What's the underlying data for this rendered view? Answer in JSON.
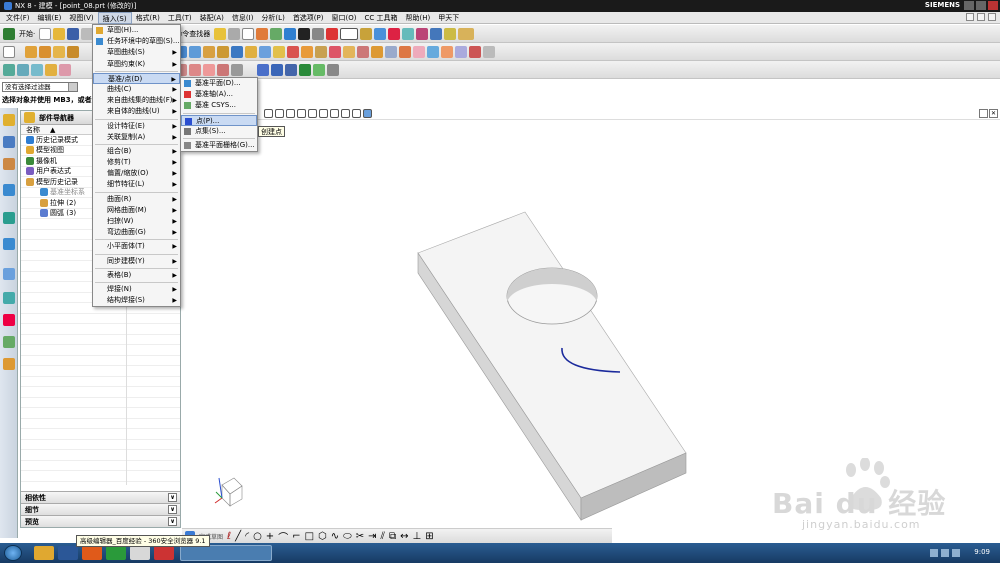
{
  "window": {
    "title": "NX 8 - 建模 - [point_08.prt (修改的)]",
    "brand": "SIEMENS"
  },
  "menubar": [
    "文件(F)",
    "编辑(E)",
    "视图(V)",
    "插入(S)",
    "格式(R)",
    "工具(T)",
    "装配(A)",
    "信息(I)",
    "分析(L)",
    "首选项(P)",
    "窗口(O)",
    "CC 工具箱",
    "帮助(H)",
    "甲天下"
  ],
  "toolbar": {
    "start": "开始·",
    "command_finder": "命令查找器"
  },
  "selection": {
    "filter": "没有选择过滤器",
    "hint": "选择对象并使用 MB3，或者双"
  },
  "navigator": {
    "title": "部件导航器",
    "column_name": "名称",
    "tree": [
      {
        "label": "历史记录模式",
        "indent": 0
      },
      {
        "label": "模型视图",
        "indent": 0
      },
      {
        "label": "摄像机",
        "indent": 0
      },
      {
        "label": "用户表达式",
        "indent": 0
      },
      {
        "label": "模型历史记录",
        "indent": 0
      },
      {
        "label": "基准坐标系",
        "indent": 1
      },
      {
        "label": "拉伸 (2)",
        "indent": 1
      },
      {
        "label": "圆弧 (3)",
        "indent": 1
      }
    ],
    "sections": [
      "相依性",
      "细节",
      "预览"
    ]
  },
  "insert_menu": [
    {
      "label": "草图(H)...",
      "sub": false
    },
    {
      "label": "任务环境中的草图(S)...",
      "sub": false
    },
    {
      "label": "草图曲线(S)",
      "sub": true
    },
    {
      "label": "草图约束(K)",
      "sub": true
    },
    {
      "sep": true
    },
    {
      "label": "基准/点(D)",
      "sub": true,
      "hl": true
    },
    {
      "label": "曲线(C)",
      "sub": true
    },
    {
      "label": "来自曲线集的曲线(F)",
      "sub": true
    },
    {
      "label": "来自体的曲线(U)",
      "sub": true
    },
    {
      "sep": true
    },
    {
      "label": "设计特征(E)",
      "sub": true
    },
    {
      "label": "关联复制(A)",
      "sub": true
    },
    {
      "sep": true
    },
    {
      "label": "组合(B)",
      "sub": true
    },
    {
      "label": "修剪(T)",
      "sub": true
    },
    {
      "label": "偏置/缩放(O)",
      "sub": true
    },
    {
      "label": "细节特征(L)",
      "sub": true
    },
    {
      "sep": true
    },
    {
      "label": "曲面(R)",
      "sub": true
    },
    {
      "label": "网格曲面(M)",
      "sub": true
    },
    {
      "label": "扫掠(W)",
      "sub": true
    },
    {
      "label": "弯边曲面(G)",
      "sub": true
    },
    {
      "sep": true
    },
    {
      "label": "小平面体(T)",
      "sub": true
    },
    {
      "sep": true
    },
    {
      "label": "同步建模(Y)",
      "sub": true
    },
    {
      "sep": true
    },
    {
      "label": "表格(B)",
      "sub": true
    },
    {
      "sep": true
    },
    {
      "label": "焊接(N)",
      "sub": true
    },
    {
      "label": "结构焊接(S)",
      "sub": true
    }
  ],
  "datum_menu": [
    {
      "label": "基准平面(D)...",
      "hl": false
    },
    {
      "label": "基准轴(A)...",
      "hl": false
    },
    {
      "label": "基准 CSYS...",
      "hl": false
    },
    {
      "sep": true
    },
    {
      "label": "点(P)...",
      "hl": true
    },
    {
      "label": "点集(S)...",
      "hl": false
    },
    {
      "sep": true
    },
    {
      "label": "基准平面栅格(G)...",
      "hl": false
    }
  ],
  "tooltip": "创建点",
  "taskbar": {
    "tooltip": "高级编辑器_百度经验 - 360安全浏览器 9.1",
    "clock": "9:09"
  },
  "view_toolbar_label": "完成草图",
  "watermark": {
    "logo": "Bai du 经验",
    "url": "jingyan.baidu.com"
  },
  "colors": {
    "model_top": "#f3f3f3",
    "model_front": "#d8d8d8",
    "model_side": "#bcbcbc",
    "arc": "#1b2a9c"
  }
}
